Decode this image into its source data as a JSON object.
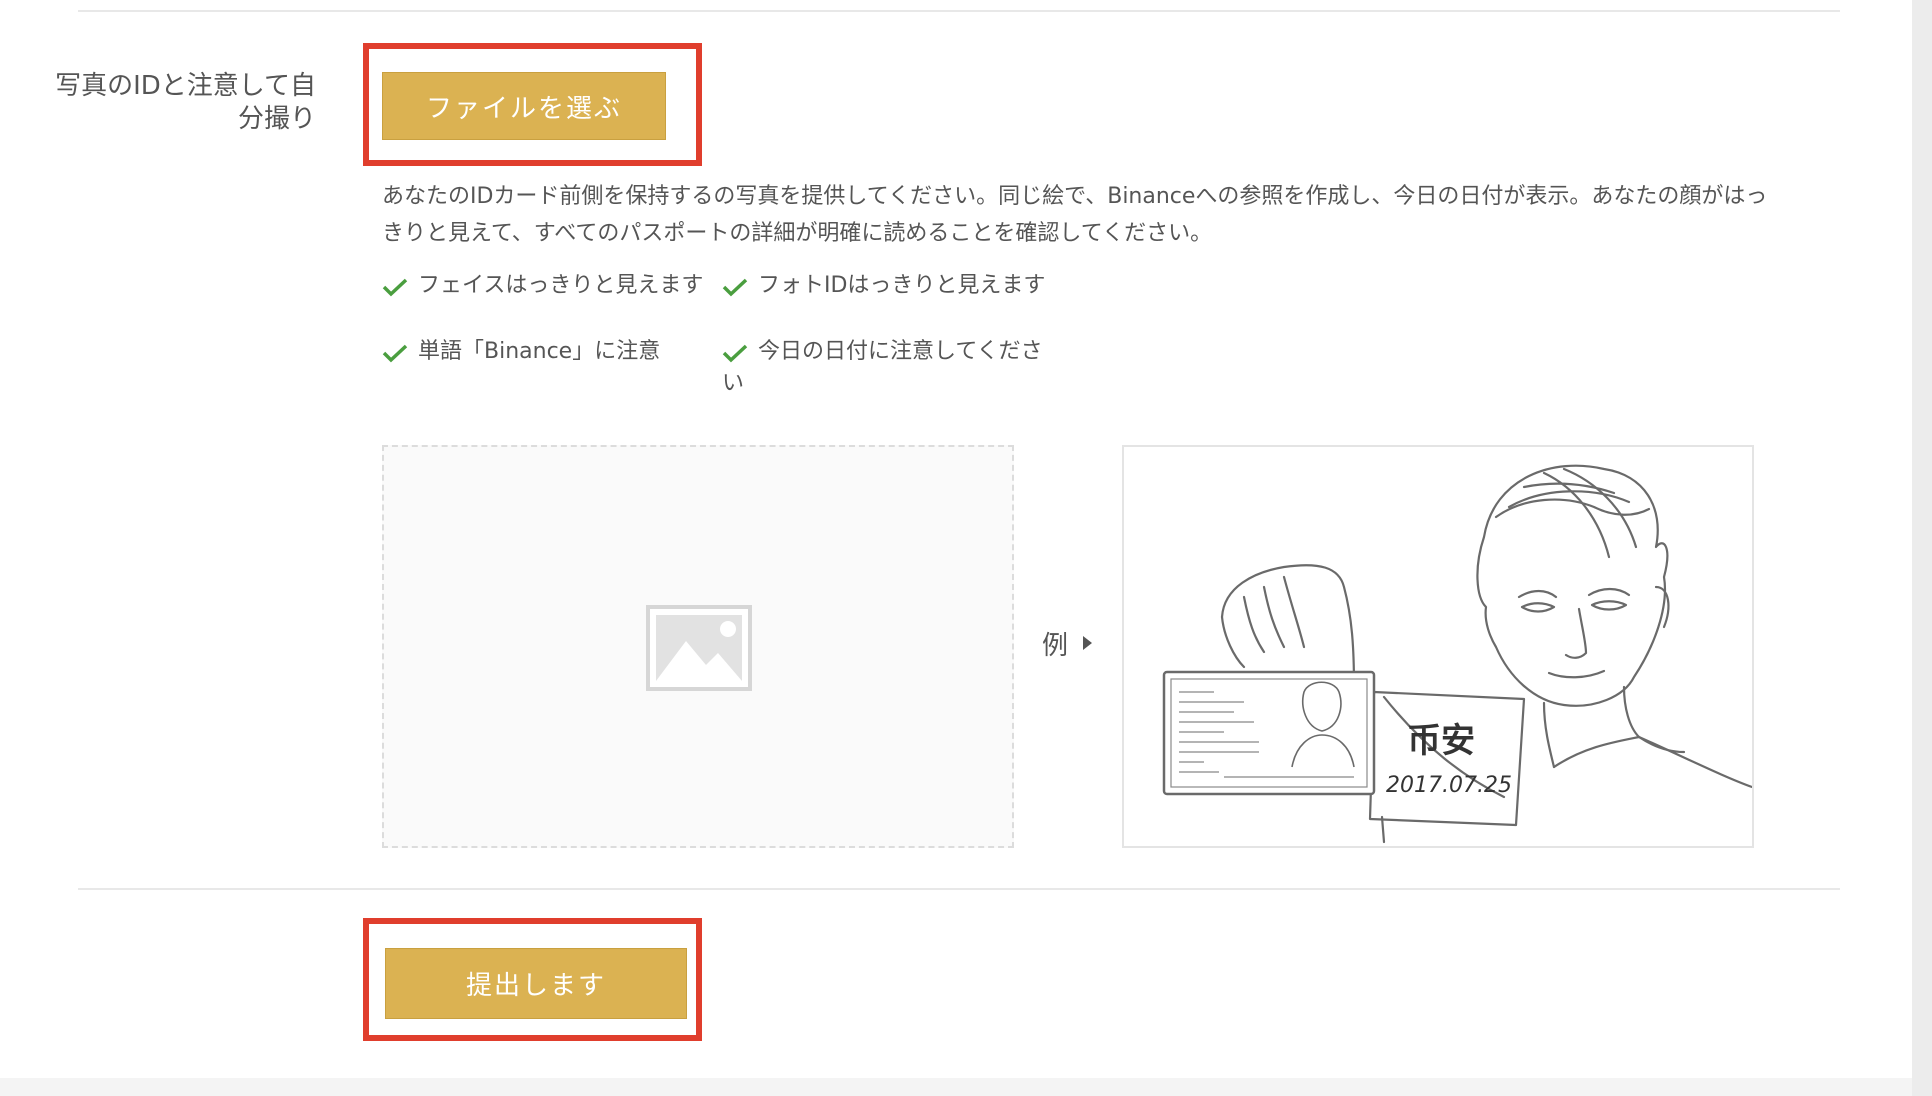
{
  "form": {
    "field_label": "写真のIDと注意して自分撮り",
    "choose_file_label": "ファイルを選ぶ",
    "description": "あなたのIDカード前側を保持するの写真を提供してください。同じ絵で、Binanceへの参照を作成し、今日の日付が表示。あなたの顔がはっきりと見えて、すべてのパスポートの詳細が明確に読めることを確認してください。",
    "checklist": [
      "フェイスはっきりと見えます",
      "フォトIDはっきりと見えます",
      "単語「Binance」に注意",
      "今日の日付に注意してください"
    ],
    "example_label": "例",
    "example_note_chars": "币安",
    "example_note_date": "2017.07.25",
    "submit_label": "提出します"
  },
  "colors": {
    "button": "#dbb252",
    "highlight": "#e03e2d",
    "check": "#4a9e3f"
  },
  "icons": {
    "check": "check-icon",
    "placeholder": "image-placeholder-icon",
    "arrow": "caret-right-icon"
  }
}
